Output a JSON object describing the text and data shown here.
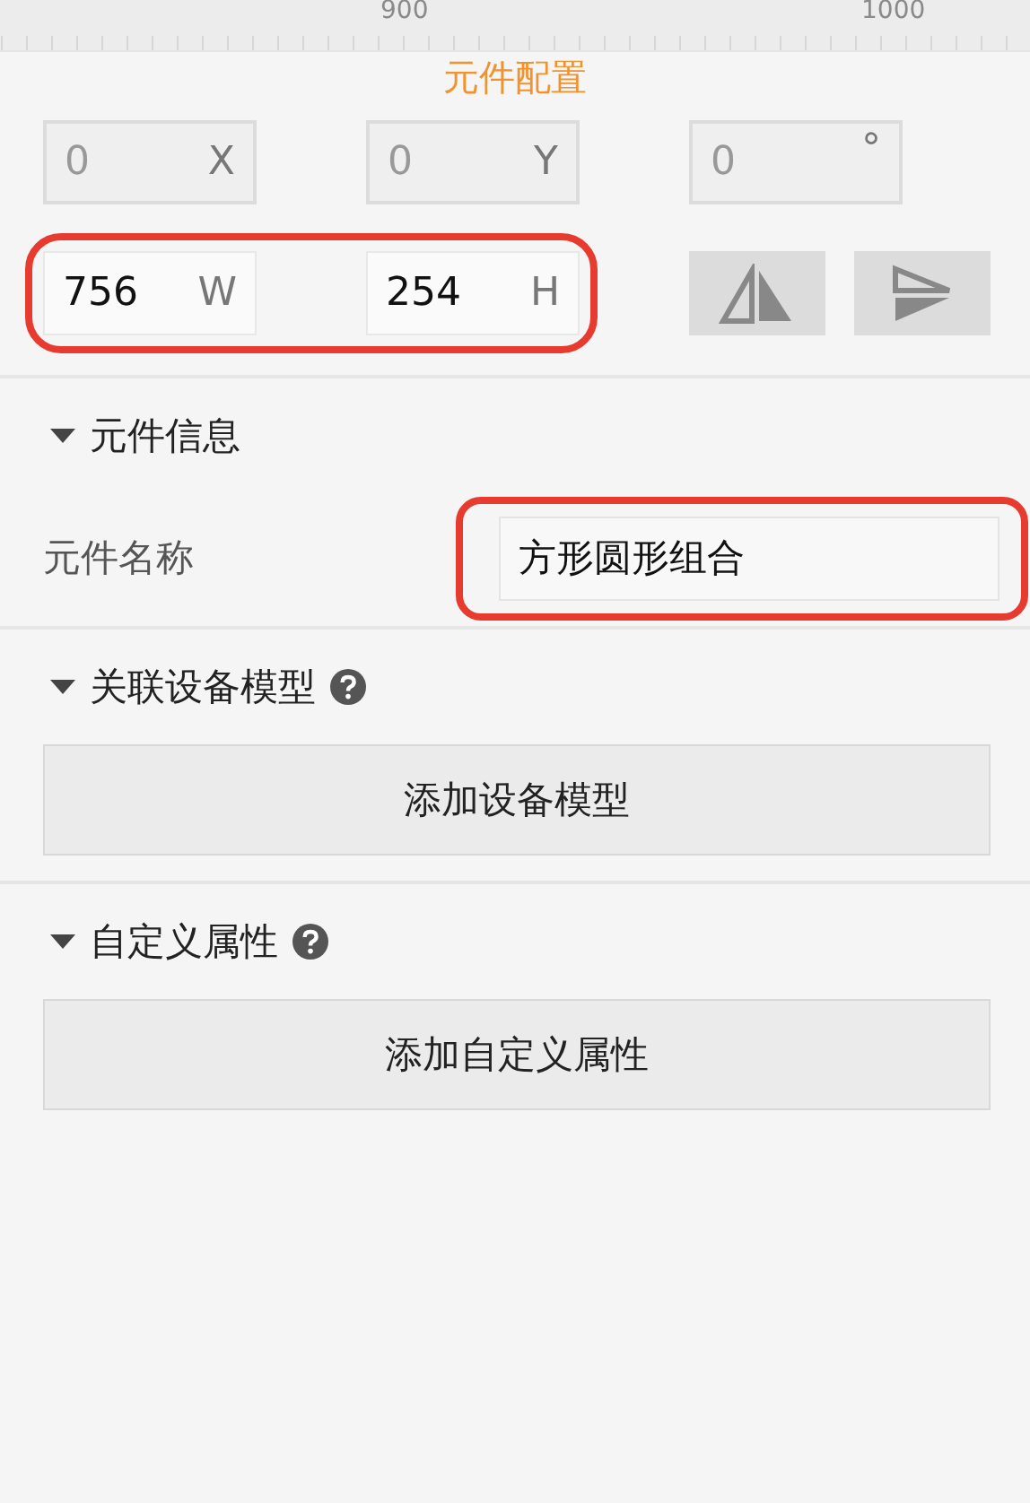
{
  "ruler": {
    "labels": [
      "900",
      "1000"
    ]
  },
  "title": "元件配置",
  "position_fields": [
    {
      "value": "0",
      "unit": "X",
      "disabled": true
    },
    {
      "value": "0",
      "unit": "Y",
      "disabled": true
    },
    {
      "value": "0",
      "unit": "°",
      "disabled": true
    }
  ],
  "size_fields": {
    "highlighted": true,
    "fields": [
      {
        "value": "756",
        "unit": "W",
        "disabled": false
      },
      {
        "value": "254",
        "unit": "H",
        "disabled": false
      }
    ]
  },
  "flip_buttons": [
    {
      "kind": "horizontal"
    },
    {
      "kind": "vertical"
    }
  ],
  "sections": [
    {
      "title": "元件信息",
      "expanded": true,
      "help": false,
      "kind": "field",
      "label": "元件名称",
      "value": "方形圆形组合",
      "highlighted": true
    },
    {
      "title": "关联设备模型",
      "expanded": true,
      "help": true,
      "kind": "button",
      "button": "添加设备模型"
    },
    {
      "title": "自定义属性",
      "expanded": true,
      "help": true,
      "kind": "button",
      "button": "添加自定义属性"
    }
  ]
}
